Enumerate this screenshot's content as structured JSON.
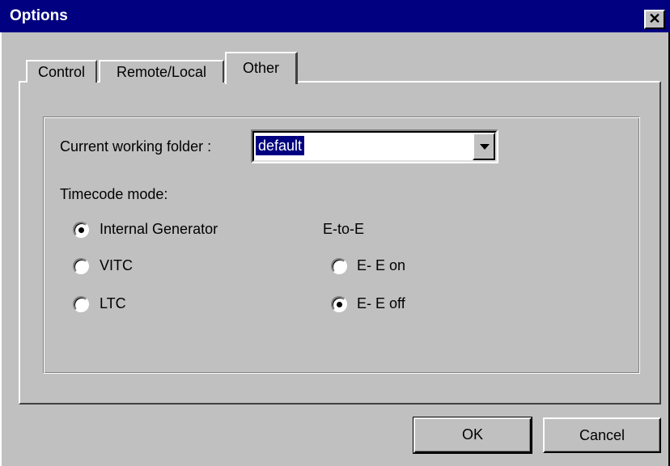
{
  "window": {
    "title": "Options",
    "close_glyph": "✕"
  },
  "tabs": [
    {
      "label": "Control",
      "active": false
    },
    {
      "label": "Remote/Local",
      "active": false
    },
    {
      "label": "Other",
      "active": true
    }
  ],
  "folder": {
    "label": "Current working folder :",
    "value": "default"
  },
  "timecode": {
    "label": "Timecode mode:",
    "options": [
      {
        "label": "Internal Generator",
        "selected": true
      },
      {
        "label": "VITC",
        "selected": false
      },
      {
        "label": "LTC",
        "selected": false
      }
    ]
  },
  "e_to_e": {
    "label": "E-to-E",
    "options": [
      {
        "label": "E- E on",
        "selected": false
      },
      {
        "label": "E- E off",
        "selected": true
      }
    ]
  },
  "buttons": {
    "ok": "OK",
    "cancel": "Cancel"
  },
  "colors": {
    "title_bar": "#000080",
    "face": "#c0c0c0",
    "selection": "#000080"
  }
}
